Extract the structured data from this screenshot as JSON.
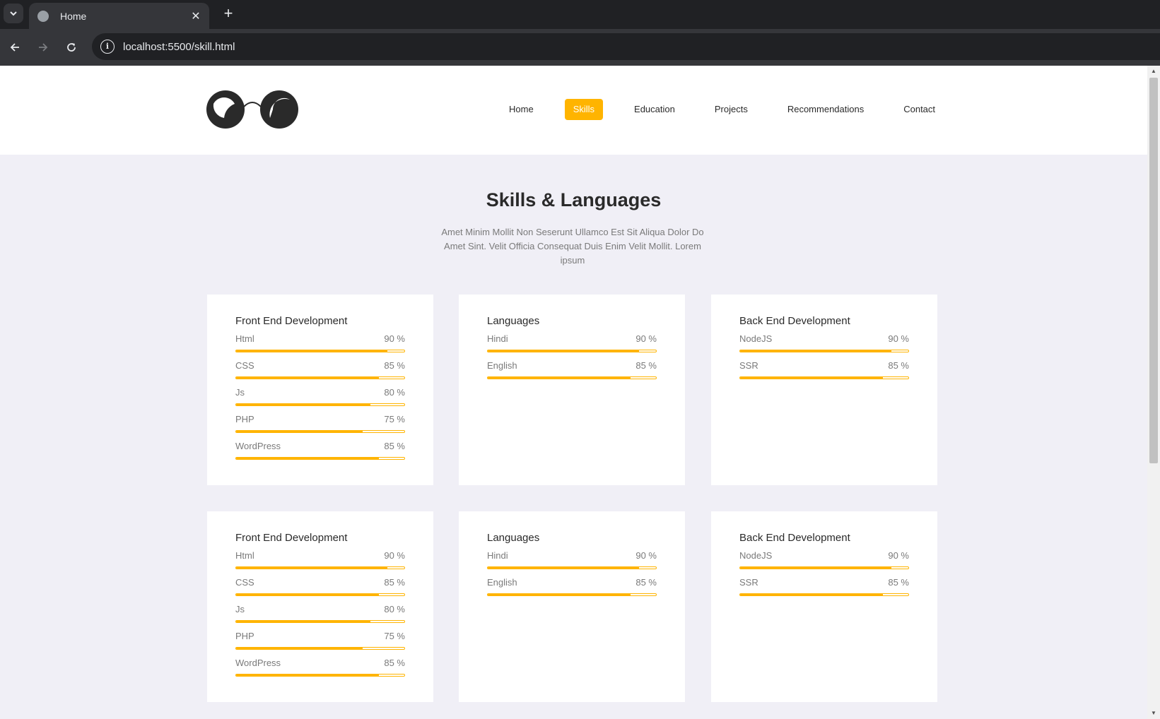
{
  "browser": {
    "tab_title": "Home",
    "tab_close": "✕",
    "new_tab": "+",
    "url": "localhost:5500/skill.html",
    "info": "i"
  },
  "nav": {
    "items": [
      {
        "label": "Home",
        "active": false
      },
      {
        "label": "Skills",
        "active": true
      },
      {
        "label": "Education",
        "active": false
      },
      {
        "label": "Projects",
        "active": false
      },
      {
        "label": "Recommendations",
        "active": false
      },
      {
        "label": "Contact",
        "active": false
      }
    ]
  },
  "hero": {
    "title": "Skills & Languages",
    "description": "Amet Minim Mollit Non Seserunt Ullamco Est Sit Aliqua Dolor Do Amet Sint. Velit Officia Consequat Duis Enim Velit Mollit. Lorem ipsum"
  },
  "colors": {
    "accent": "#ffb400",
    "background": "#f0eff6",
    "card": "#ffffff"
  },
  "cards": [
    {
      "title": "Front End Development",
      "skills": [
        {
          "name": "Html",
          "percent_label": "90 %",
          "value": 90
        },
        {
          "name": "CSS",
          "percent_label": "85 %",
          "value": 85
        },
        {
          "name": "Js",
          "percent_label": "80 %",
          "value": 80
        },
        {
          "name": "PHP",
          "percent_label": "75 %",
          "value": 75
        },
        {
          "name": "WordPress",
          "percent_label": "85 %",
          "value": 85
        }
      ]
    },
    {
      "title": "Languages",
      "skills": [
        {
          "name": "Hindi",
          "percent_label": "90 %",
          "value": 90
        },
        {
          "name": "English",
          "percent_label": "85 %",
          "value": 85
        }
      ]
    },
    {
      "title": "Back End Development",
      "skills": [
        {
          "name": "NodeJS",
          "percent_label": "90 %",
          "value": 90
        },
        {
          "name": "SSR",
          "percent_label": "85 %",
          "value": 85
        }
      ]
    },
    {
      "title": "Front End Development",
      "skills": [
        {
          "name": "Html",
          "percent_label": "90 %",
          "value": 90
        },
        {
          "name": "CSS",
          "percent_label": "85 %",
          "value": 85
        },
        {
          "name": "Js",
          "percent_label": "80 %",
          "value": 80
        },
        {
          "name": "PHP",
          "percent_label": "75 %",
          "value": 75
        },
        {
          "name": "WordPress",
          "percent_label": "85 %",
          "value": 85
        }
      ]
    },
    {
      "title": "Languages",
      "skills": [
        {
          "name": "Hindi",
          "percent_label": "90 %",
          "value": 90
        },
        {
          "name": "English",
          "percent_label": "85 %",
          "value": 85
        }
      ]
    },
    {
      "title": "Back End Development",
      "skills": [
        {
          "name": "NodeJS",
          "percent_label": "90 %",
          "value": 90
        },
        {
          "name": "SSR",
          "percent_label": "85 %",
          "value": 85
        }
      ]
    }
  ]
}
